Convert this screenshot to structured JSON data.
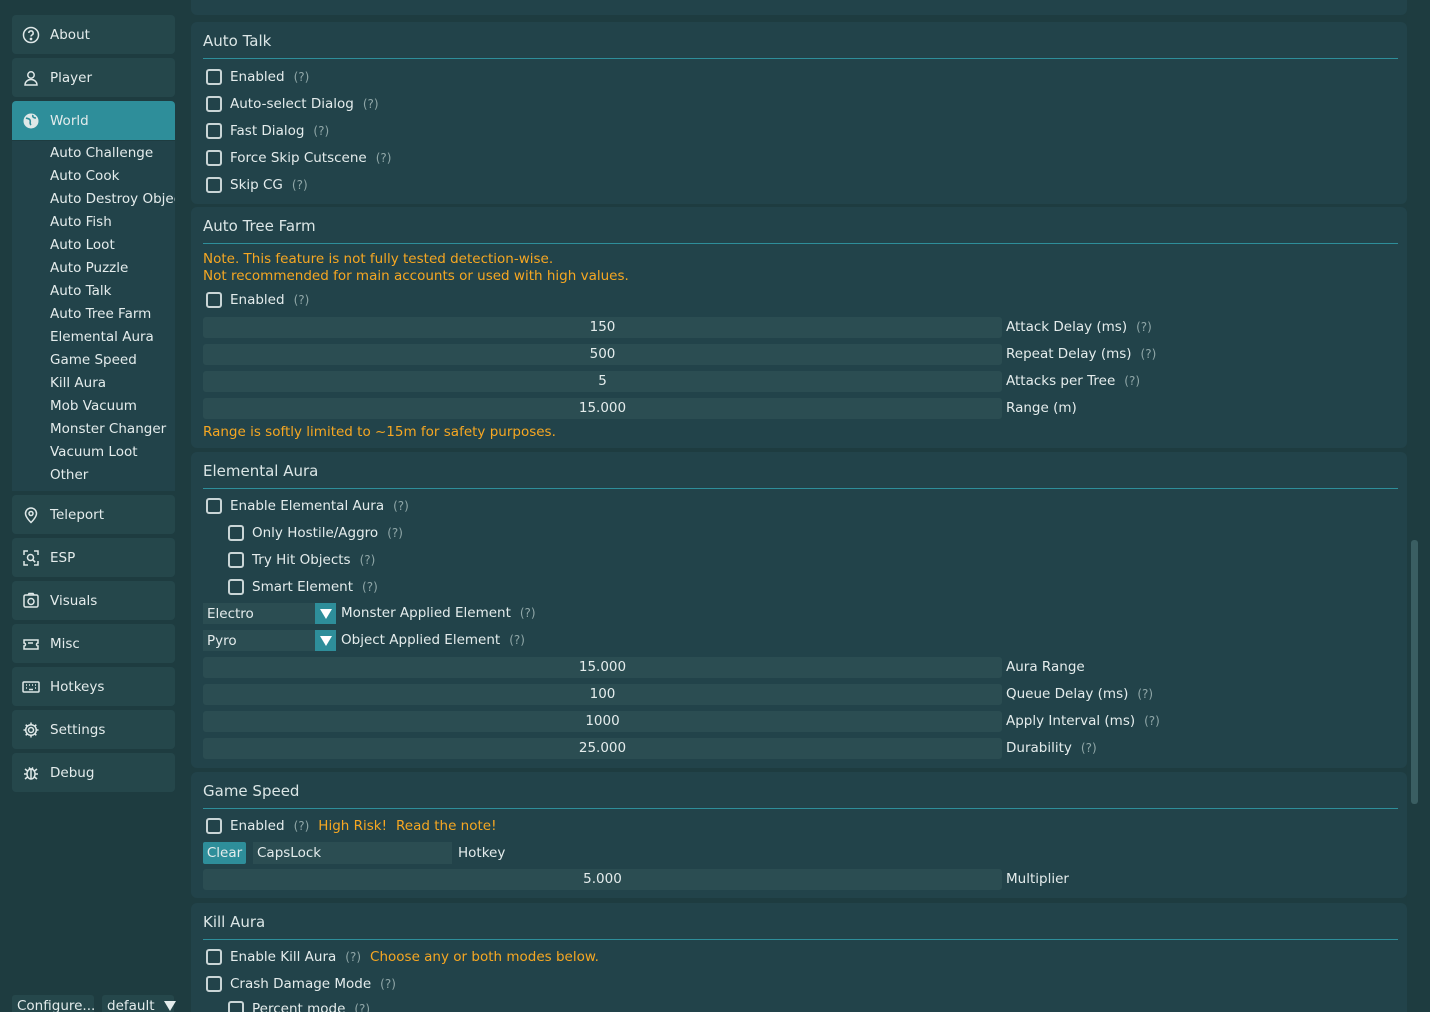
{
  "sidebar": {
    "nav_top": [
      {
        "label": "About",
        "icon": "question-circle-icon"
      },
      {
        "label": "Player",
        "icon": "user-icon"
      },
      {
        "label": "World",
        "icon": "globe-icon"
      }
    ],
    "world_subitems": [
      "Auto Challenge",
      "Auto Cook",
      "Auto Destroy Objec",
      "Auto Fish",
      "Auto Loot",
      "Auto Puzzle",
      "Auto Talk",
      "Auto Tree Farm",
      "Elemental Aura",
      "Game Speed",
      "Kill Aura",
      "Mob Vacuum",
      "Monster Changer",
      "Vacuum Loot",
      "Other"
    ],
    "nav_bottom": [
      {
        "label": "Teleport",
        "icon": "map-pin-icon"
      },
      {
        "label": "ESP",
        "icon": "scan-icon"
      },
      {
        "label": "Visuals",
        "icon": "camera-icon"
      },
      {
        "label": "Misc",
        "icon": "ticket-icon"
      },
      {
        "label": "Hotkeys",
        "icon": "keyboard-icon"
      },
      {
        "label": "Settings",
        "icon": "gear-icon"
      },
      {
        "label": "Debug",
        "icon": "bug-icon"
      }
    ],
    "footer": {
      "configure_label": "Configure...",
      "profile_label": "default"
    }
  },
  "help_mark": "(?)",
  "colors": {
    "accent": "#2e8e9a",
    "warning": "#f6a722",
    "panel": "#22434a",
    "background": "#1e3c40"
  },
  "auto_talk": {
    "title": "Auto Talk",
    "options": [
      "Enabled",
      "Auto-select Dialog",
      "Fast Dialog",
      "Force Skip Cutscene",
      "Skip CG"
    ]
  },
  "auto_tree_farm": {
    "title": "Auto Tree Farm",
    "note_line1": "Note. This feature is not fully tested detection-wise.",
    "note_line2": "Not recommended for main accounts or used with high values.",
    "enabled_label": "Enabled",
    "sliders": [
      {
        "value": "150",
        "label": "Attack Delay (ms)",
        "help": true
      },
      {
        "value": "500",
        "label": "Repeat Delay (ms)",
        "help": true
      },
      {
        "value": "5",
        "label": "Attacks per Tree",
        "help": true
      },
      {
        "value": "15.000",
        "label": "Range (m)",
        "help": false
      }
    ],
    "range_note": "Range is softly limited to ~15m for safety purposes."
  },
  "elemental_aura": {
    "title": "Elemental Aura",
    "enable_label": "Enable Elemental Aura",
    "sub_options": [
      "Only Hostile/Aggro",
      "Try Hit Objects",
      "Smart Element"
    ],
    "combos": [
      {
        "value": "Electro",
        "label": "Monster Applied Element"
      },
      {
        "value": "Pyro",
        "label": "Object Applied Element"
      }
    ],
    "sliders": [
      {
        "value": "15.000",
        "label": "Aura Range",
        "help": false
      },
      {
        "value": "100",
        "label": "Queue Delay (ms)",
        "help": true
      },
      {
        "value": "1000",
        "label": "Apply Interval (ms)",
        "help": true
      },
      {
        "value": "25.000",
        "label": "Durability",
        "help": true
      }
    ]
  },
  "game_speed": {
    "title": "Game Speed",
    "enabled_label": "Enabled",
    "risk_label": "High Risk!",
    "read_note_label": "Read the note!",
    "clear_label": "Clear",
    "hotkey_value": "CapsLock",
    "hotkey_label": "Hotkey",
    "multiplier_value": "5.000",
    "multiplier_label": "Multiplier"
  },
  "kill_aura": {
    "title": "Kill Aura",
    "enable_label": "Enable Kill Aura",
    "modes_note": "Choose any or both modes below.",
    "crash_label": "Crash Damage Mode",
    "percent_label": "Percent mode"
  }
}
